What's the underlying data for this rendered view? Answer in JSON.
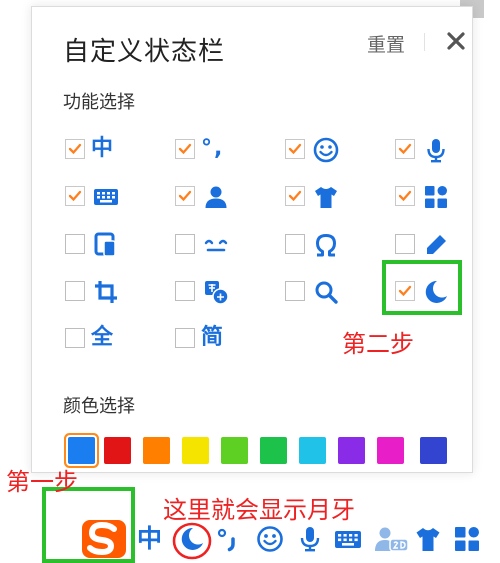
{
  "panel": {
    "title": "自定义状态栏",
    "reset_label": "重置",
    "close_icon": "close-icon"
  },
  "functions": {
    "label": "功能选择",
    "items": [
      {
        "icon": "zhong-text",
        "text": "中",
        "checked": true
      },
      {
        "icon": "punctuation-icon",
        "text": "°,",
        "checked": true
      },
      {
        "icon": "emoji-icon",
        "checked": true
      },
      {
        "icon": "microphone-icon",
        "checked": true
      },
      {
        "icon": "keyboard-icon",
        "checked": true
      },
      {
        "icon": "user-icon",
        "checked": true
      },
      {
        "icon": "tshirt-icon",
        "checked": true
      },
      {
        "icon": "apps-grid-icon",
        "checked": true
      },
      {
        "icon": "device-icon",
        "checked": false
      },
      {
        "icon": "face-icon",
        "checked": false
      },
      {
        "icon": "omega-icon",
        "checked": false
      },
      {
        "icon": "pencil-icon",
        "checked": false
      },
      {
        "icon": "crop-icon",
        "checked": false
      },
      {
        "icon": "translate-icon",
        "checked": false
      },
      {
        "icon": "search-icon",
        "checked": false
      },
      {
        "icon": "moon-icon",
        "checked": true
      },
      {
        "icon": "quan-text",
        "text": "全",
        "checked": false
      },
      {
        "icon": "jian-text",
        "text": "简",
        "checked": false
      }
    ]
  },
  "colors": {
    "label": "颜色选择",
    "swatches": [
      "#1a7df0",
      "#e11515",
      "#ff7f00",
      "#f5e400",
      "#5ecf23",
      "#1cc24a",
      "#21c2e8",
      "#8a2be8",
      "#e81ec8",
      "#3345d0"
    ],
    "selected_index": 0,
    "checkmark_color": "#ff7f1e",
    "icon_color": "#1a6fdc"
  },
  "annotations": {
    "step1": "第一步",
    "step2": "第二步",
    "moon_note": "这里就会显示月牙"
  },
  "statusbar": {
    "items": [
      "sogou-logo-icon",
      "中",
      "moon-icon",
      "punctuation-icon",
      "emoji-icon",
      "microphone-icon",
      "keyboard-icon",
      "user-icon",
      "tshirt-icon",
      "apps-grid-icon"
    ]
  }
}
